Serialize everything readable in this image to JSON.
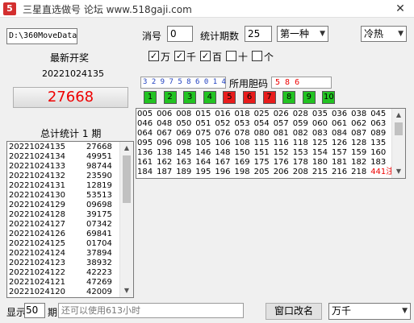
{
  "window": {
    "title": "三星直选做号  论坛 www.518gaji.com",
    "icon_text": "5",
    "close_symbol": "✕"
  },
  "toolbar": {
    "path": "D:\\360MoveData",
    "xiaohao_label": "消号",
    "xiaohao_value": "0",
    "stat_periods_label": "统计期数",
    "stat_periods_value": "25",
    "method_value": "第一种",
    "heat_value": "冷热"
  },
  "position_checks": [
    {
      "label": "万",
      "checked": true
    },
    {
      "label": "千",
      "checked": true
    },
    {
      "label": "百",
      "checked": true
    },
    {
      "label": "十",
      "checked": false
    },
    {
      "label": "个",
      "checked": false
    }
  ],
  "latest": {
    "title": "最新开奖",
    "issue": "20221024135",
    "number": "27668"
  },
  "total": {
    "label": "总计统计",
    "count": "1",
    "unit": "期"
  },
  "history": [
    {
      "issue": "20221024135",
      "number": "27668"
    },
    {
      "issue": "20221024134",
      "number": "49951"
    },
    {
      "issue": "20221024133",
      "number": "98744"
    },
    {
      "issue": "20221024132",
      "number": "23590"
    },
    {
      "issue": "20221024131",
      "number": "12819"
    },
    {
      "issue": "20221024130",
      "number": "53513"
    },
    {
      "issue": "20221024129",
      "number": "09698"
    },
    {
      "issue": "20221024128",
      "number": "39175"
    },
    {
      "issue": "20221024127",
      "number": "07342"
    },
    {
      "issue": "20221024126",
      "number": "69841"
    },
    {
      "issue": "20221024125",
      "number": "01704"
    },
    {
      "issue": "20221024124",
      "number": "37894"
    },
    {
      "issue": "20221024123",
      "number": "38932"
    },
    {
      "issue": "20221024122",
      "number": "42223"
    },
    {
      "issue": "20221024121",
      "number": "47269"
    },
    {
      "issue": "20221024120",
      "number": "42009"
    }
  ],
  "history_scroll_fraction": 0.35,
  "digits": {
    "sequence": "3 2 9 7 5 8 6 0 1 4",
    "used_label": "所用胆码",
    "used_digits": "5 8 6",
    "buttons": [
      {
        "label": "1",
        "color": "#22c322"
      },
      {
        "label": "2",
        "color": "#22c322"
      },
      {
        "label": "3",
        "color": "#22c322"
      },
      {
        "label": "4",
        "color": "#22c322"
      },
      {
        "label": "5",
        "color": "#e81c1c"
      },
      {
        "label": "6",
        "color": "#e81c1c"
      },
      {
        "label": "7",
        "color": "#e81c1c"
      },
      {
        "label": "8",
        "color": "#22c322"
      },
      {
        "label": "9",
        "color": "#22c322"
      },
      {
        "label": "10",
        "color": "#22c322"
      }
    ]
  },
  "grid": {
    "rows": [
      [
        "005",
        "006",
        "008",
        "015",
        "016",
        "018",
        "025",
        "026",
        "028",
        "035",
        "036",
        "038",
        "045"
      ],
      [
        "046",
        "048",
        "050",
        "051",
        "052",
        "053",
        "054",
        "057",
        "059",
        "060",
        "061",
        "062",
        "063"
      ],
      [
        "064",
        "067",
        "069",
        "075",
        "076",
        "078",
        "080",
        "081",
        "082",
        "083",
        "084",
        "087",
        "089"
      ],
      [
        "095",
        "096",
        "098",
        "105",
        "106",
        "108",
        "115",
        "116",
        "118",
        "125",
        "126",
        "128",
        "135"
      ],
      [
        "136",
        "138",
        "145",
        "146",
        "148",
        "150",
        "151",
        "152",
        "153",
        "154",
        "157",
        "159",
        "160"
      ],
      [
        "161",
        "162",
        "163",
        "164",
        "167",
        "169",
        "175",
        "176",
        "178",
        "180",
        "181",
        "182",
        "183"
      ],
      [
        "184",
        "187",
        "189",
        "195",
        "196",
        "198",
        "205",
        "206",
        "208",
        "215",
        "216",
        "218"
      ]
    ],
    "count_text": "441注"
  },
  "footer": {
    "show_label": "显示",
    "show_value": "50",
    "show_unit": "期",
    "hint": "还可以使用613小时",
    "rename_button": "窗口改名",
    "mode_value": "万千"
  }
}
